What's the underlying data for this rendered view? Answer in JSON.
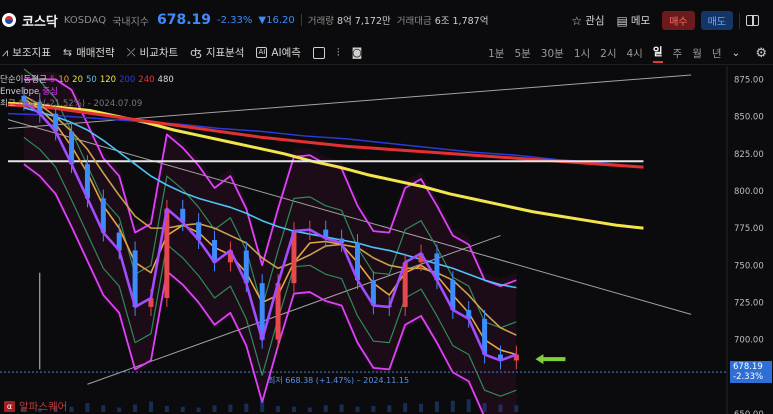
{
  "header": {
    "name": "코스닥",
    "code": "KOSDAQ",
    "type": "국내지수",
    "price": "678.19",
    "change_pct": "-2.33%",
    "change": "▼16.20",
    "volume_label": "거래량",
    "volume": "8억 7,172만",
    "amount_label": "거래대금",
    "amount": "6조 1,787억",
    "watch_label": "관심",
    "memo_label": "메모",
    "buy_label": "매수",
    "sell_label": "매도"
  },
  "toolbar": {
    "items": [
      "보조지표",
      "매매전략",
      "비교차트",
      "지표분석",
      "AI예측"
    ],
    "timeframes": [
      "1분",
      "5분",
      "30분",
      "1시",
      "2시",
      "4시",
      "일",
      "주",
      "월",
      "년"
    ],
    "active_timeframe": "일"
  },
  "legend": {
    "ma_title": "단순이동평균",
    "ma_periods": [
      "5",
      "10",
      "20",
      "50",
      "120",
      "200",
      "240",
      "480"
    ],
    "envelope_title": "Envelope",
    "envelope_mid": "중심",
    "high_label": "최고",
    "high_text": "864.1(-21.52%) - 2024.07.09"
  },
  "low_label": "최저 668.38 (+1.47%) – 2024.11.15",
  "price_tag": {
    "price": "678.19",
    "pct": "-2.33%"
  },
  "watermark": "알파스퀘어",
  "colors": {
    "up": "#e5484d",
    "down": "#3d8bfd",
    "accent": "#e03c3c",
    "arrow": "#7fd13b"
  },
  "chart_data": {
    "type": "candlestick",
    "y_axis": [
      "875.00",
      "850.00",
      "825.00",
      "800.00",
      "775.00",
      "750.00",
      "725.00",
      "700.00",
      "650.00"
    ],
    "ylim": [
      650,
      880
    ],
    "price_line": 678.19,
    "series": [
      {
        "name": "MA 5",
        "color": "#e040fb",
        "values": [
          860,
          852,
          840,
          818,
          795,
          772,
          760,
          722,
          728,
          788,
          779,
          767,
          752,
          760,
          738,
          700,
          738,
          773,
          774,
          768,
          765,
          740,
          723,
          722,
          752,
          758,
          740,
          720,
          714,
          690,
          686,
          690
        ]
      },
      {
        "name": "MA 10",
        "color": "#e7a53c",
        "values": [
          862,
          855,
          845,
          830,
          812,
          790,
          775,
          752,
          745,
          770,
          777,
          772,
          762,
          757,
          745,
          725,
          730,
          752,
          765,
          766,
          764,
          752,
          738,
          730,
          745,
          750,
          743,
          730,
          718,
          700,
          693,
          690
        ]
      },
      {
        "name": "MA 20",
        "color": "#c8a24c",
        "values": [
          864,
          858,
          850,
          840,
          828,
          812,
          797,
          783,
          775,
          775,
          777,
          778,
          775,
          770,
          765,
          755,
          748,
          752,
          757,
          763,
          764,
          762,
          755,
          750,
          748,
          748,
          745,
          740,
          730,
          718,
          708,
          703
        ]
      },
      {
        "name": "MA 50",
        "color": "#4fc3f7",
        "values": [
          856,
          853,
          850,
          846,
          841,
          834,
          826,
          818,
          810,
          804,
          799,
          795,
          792,
          789,
          785,
          780,
          776,
          773,
          771,
          769,
          767,
          765,
          762,
          760,
          757,
          754,
          751,
          748,
          744,
          740,
          737,
          735
        ]
      },
      {
        "name": "MA 120",
        "color": "#f2e44c",
        "values": [
          859,
          858,
          856,
          854,
          850,
          846,
          841,
          837,
          833,
          829,
          825,
          820,
          816,
          811,
          807,
          803,
          798,
          794,
          790,
          786,
          783,
          780,
          777,
          775
        ]
      },
      {
        "name": "MA 200",
        "color": "#2b3ad8",
        "values": [
          852,
          851,
          849,
          847,
          845,
          842,
          840,
          837,
          835,
          832,
          829,
          826,
          824,
          821,
          819,
          816
        ]
      },
      {
        "name": "MA 240",
        "color": "#e33030",
        "values": [
          858,
          856,
          852,
          848,
          844,
          840,
          836,
          833,
          830,
          828,
          826,
          824,
          822,
          820,
          818,
          816
        ]
      },
      {
        "name": "MA 480",
        "color": "#e6e6e6",
        "values": [
          820,
          820,
          820,
          820,
          820,
          820,
          820,
          820,
          820,
          820,
          820,
          820,
          820,
          820,
          820,
          820
        ]
      }
    ],
    "trendlines": [
      {
        "from": [
          0,
          842
        ],
        "to": [
          43,
          878
        ]
      },
      {
        "from": [
          0,
          848
        ],
        "to": [
          43,
          717
        ]
      },
      {
        "from": [
          5,
          670
        ],
        "to": [
          31,
          770
        ]
      }
    ],
    "volume_values": [
      30,
      25,
      40,
      35,
      60,
      45,
      30,
      50,
      70,
      40,
      35,
      30,
      45,
      50,
      55,
      80,
      40,
      35,
      30,
      45,
      50,
      35,
      40,
      45,
      60,
      55,
      70,
      75,
      85,
      60,
      50,
      45
    ]
  }
}
